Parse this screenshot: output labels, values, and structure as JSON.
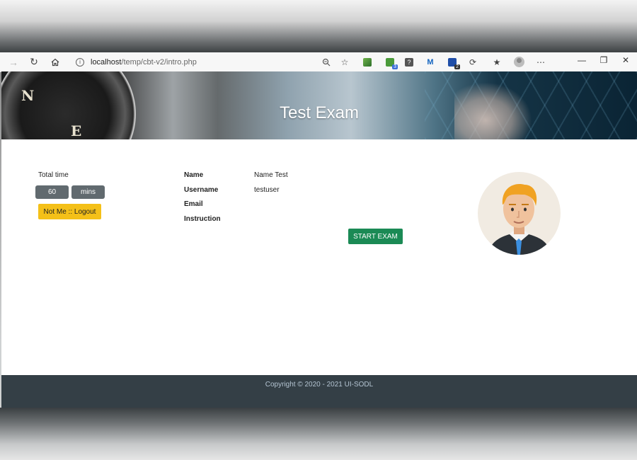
{
  "browser": {
    "url_host": "localhost",
    "url_path": "/temp/cbt-v2/intro.php",
    "extension_badges": [
      "3",
      "2"
    ]
  },
  "banner": {
    "title": "Test Exam"
  },
  "timer": {
    "label": "Total time",
    "value": "60",
    "unit": "mins"
  },
  "logout_button": "Not Me :: Logout",
  "candidate": {
    "fields": [
      {
        "label": "Name",
        "value": "Name Test"
      },
      {
        "label": "Username",
        "value": "testuser"
      },
      {
        "label": "Email",
        "value": ""
      },
      {
        "label": "Instruction",
        "value": ""
      }
    ]
  },
  "start_button": "START EXAM",
  "footer": {
    "copyright": "Copyright © 2020 - 2021 UI-SODL"
  },
  "colors": {
    "footer_bg": "#343f46",
    "start_button": "#1b8a55",
    "logout_button": "#f4c018",
    "timer_box": "#616a6f"
  }
}
